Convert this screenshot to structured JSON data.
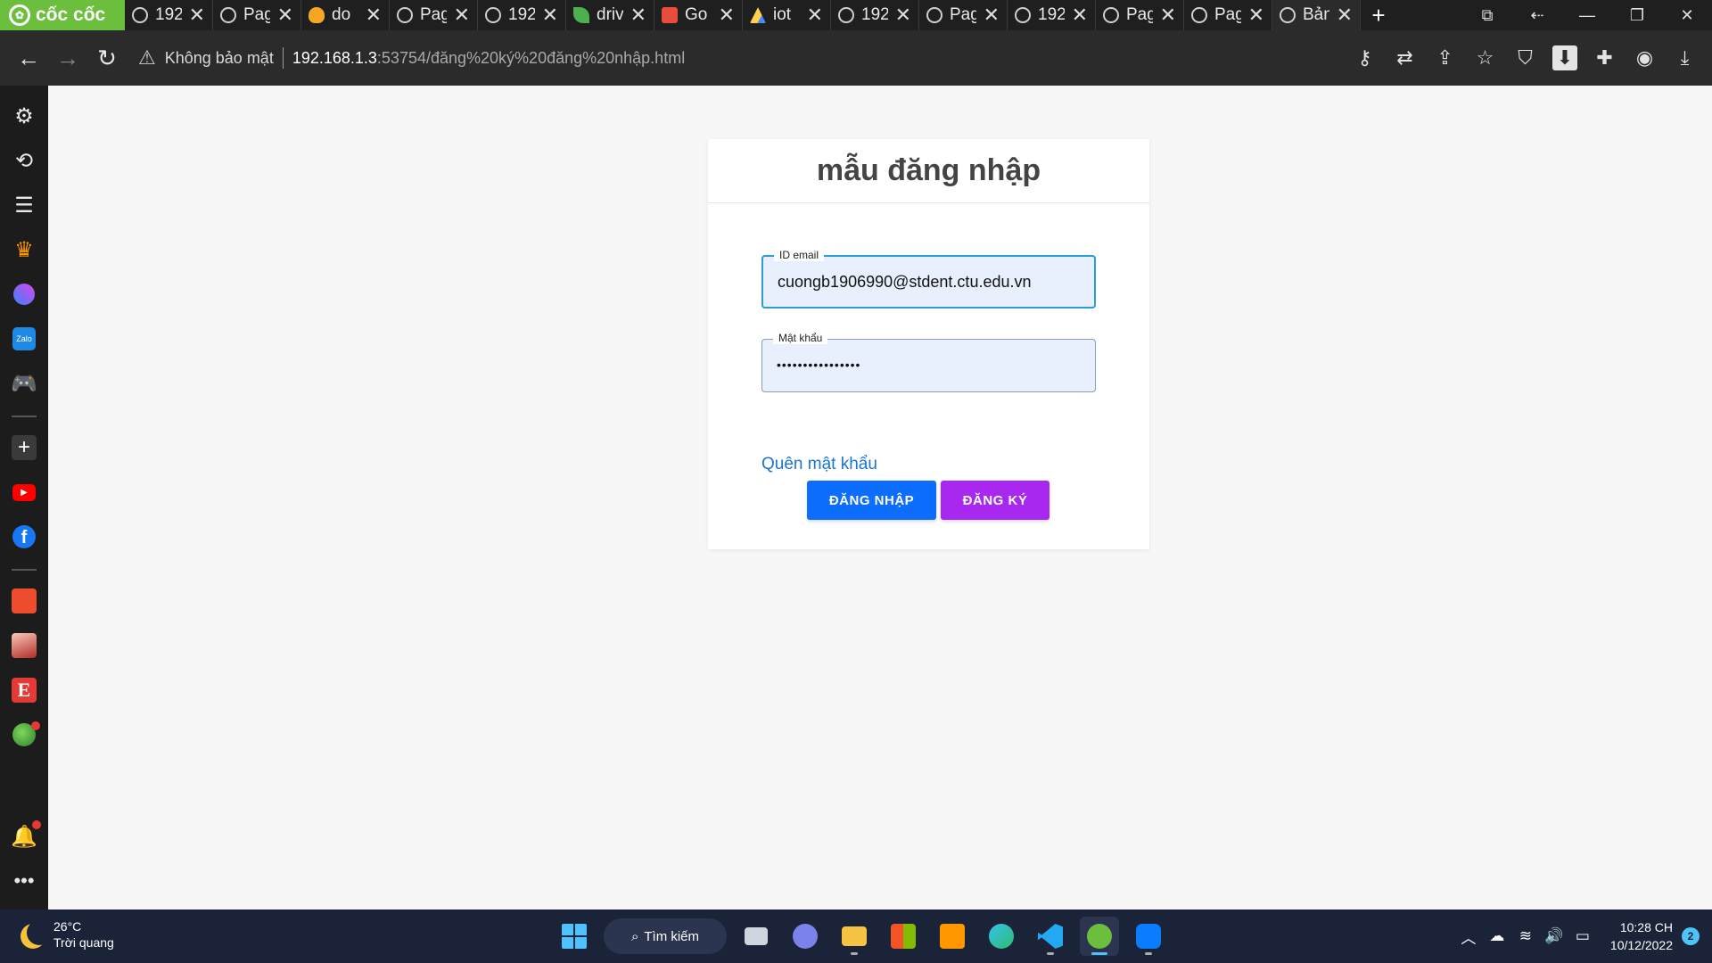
{
  "browser": {
    "brand_name": "cốc cốc",
    "tabs": [
      {
        "title": "192",
        "favicon": "globe-icon"
      },
      {
        "title": "Pag",
        "favicon": "globe-icon"
      },
      {
        "title": "do",
        "favicon": "firebase-icon"
      },
      {
        "title": "Pag",
        "favicon": "globe-icon"
      },
      {
        "title": "192",
        "favicon": "globe-icon"
      },
      {
        "title": "driv",
        "favicon": "leaf-icon"
      },
      {
        "title": "Go",
        "favicon": "gallery-icon"
      },
      {
        "title": "iot",
        "favicon": "drive-icon"
      },
      {
        "title": "192",
        "favicon": "globe-icon"
      },
      {
        "title": "Pag",
        "favicon": "globe-icon"
      },
      {
        "title": "192",
        "favicon": "globe-icon"
      },
      {
        "title": "Pag",
        "favicon": "globe-icon"
      },
      {
        "title": "Pag",
        "favicon": "globe-icon"
      },
      {
        "title": "Bản",
        "favicon": "globe-icon",
        "active": true
      }
    ],
    "security_label": "Không bảo mật",
    "url_host": "192.168.1.3",
    "url_path": ":53754/đăng%20ký%20đăng%20nhập.html"
  },
  "page": {
    "title": "mẫu đăng nhập",
    "email_label": "ID email",
    "email_value": "cuongb1906990@stdent.ctu.edu.vn",
    "password_label": "Mật khẩu",
    "password_value": "••••••••••••••••",
    "forgot_link": "Quên mật khẩu",
    "login_button": "ĐĂNG NHẬP",
    "register_button": "ĐĂNG KÝ",
    "colors": {
      "login": "#0d6efd",
      "register": "#a928f0",
      "link": "#1976d2"
    }
  },
  "taskbar": {
    "temperature": "26°C",
    "weather": "Trời quang",
    "search_label": "Tìm kiếm",
    "time": "10:28 CH",
    "date": "10/12/2022",
    "notifications": "2"
  }
}
